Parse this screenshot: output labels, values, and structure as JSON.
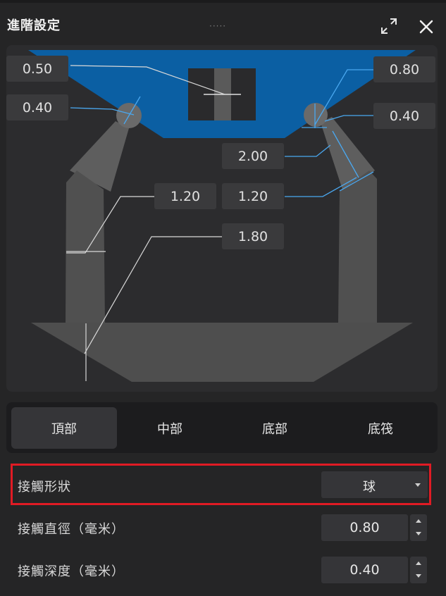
{
  "window": {
    "title": "進階設定",
    "grip": "·····",
    "expand_icon": "expand-icon",
    "close_icon": "close-icon"
  },
  "diagram": {
    "dimensions": {
      "top_left_outer": "0.50",
      "top_left_inner": "0.40",
      "top_right_outer": "0.80",
      "top_right_inner": "0.40",
      "middle_length": "2.00",
      "middle_left": "1.20",
      "middle_right": "1.20",
      "bottom": "1.80"
    },
    "colors": {
      "top_section": "#0b5fa3",
      "support": "#5e5e5e",
      "accent_line": "#4aa8f0"
    }
  },
  "tabs": [
    {
      "label": "頂部",
      "active": true
    },
    {
      "label": "中部",
      "active": false
    },
    {
      "label": "底部",
      "active": false
    },
    {
      "label": "底筏",
      "active": false
    }
  ],
  "properties": {
    "contact_shape": {
      "label": "接觸形狀",
      "value": "球"
    },
    "contact_diameter": {
      "label": "接觸直徑（毫米）",
      "value": "0.80"
    },
    "contact_depth": {
      "label": "接觸深度（毫米）",
      "value": "0.40"
    }
  }
}
